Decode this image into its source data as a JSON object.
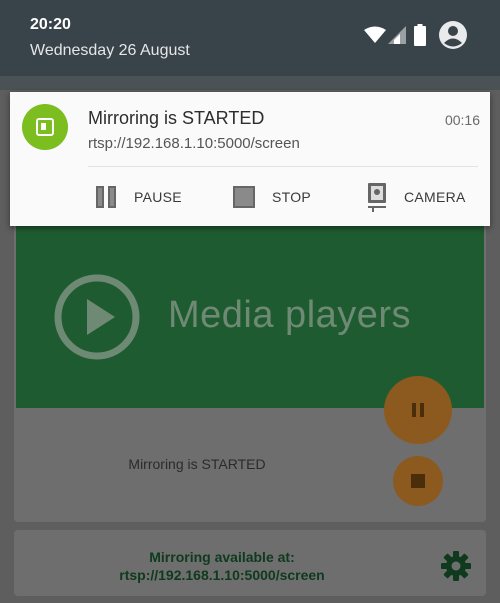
{
  "status_bar": {
    "time": "20:20",
    "date": "Wednesday 26 August"
  },
  "notification": {
    "title": "Mirroring is STARTED",
    "time": "00:16",
    "url": "rtsp://192.168.1.10:5000/screen",
    "app_icon": "mirror-app-icon",
    "actions": [
      {
        "label": "PAUSE",
        "icon": "pause-icon"
      },
      {
        "label": "STOP",
        "icon": "stop-icon"
      },
      {
        "label": "CAMERA",
        "icon": "camera-icon"
      }
    ]
  },
  "app": {
    "banner_title": "Media players",
    "status": "Mirroring is STARTED",
    "footer_line1": "Mirroring available at:",
    "footer_line2": "rtsp://192.168.1.10:5000/screen"
  },
  "colors": {
    "accent_green": "#7cbd1f",
    "banner_green": "#1f5b31",
    "fab_orange": "#8c5a1e"
  }
}
